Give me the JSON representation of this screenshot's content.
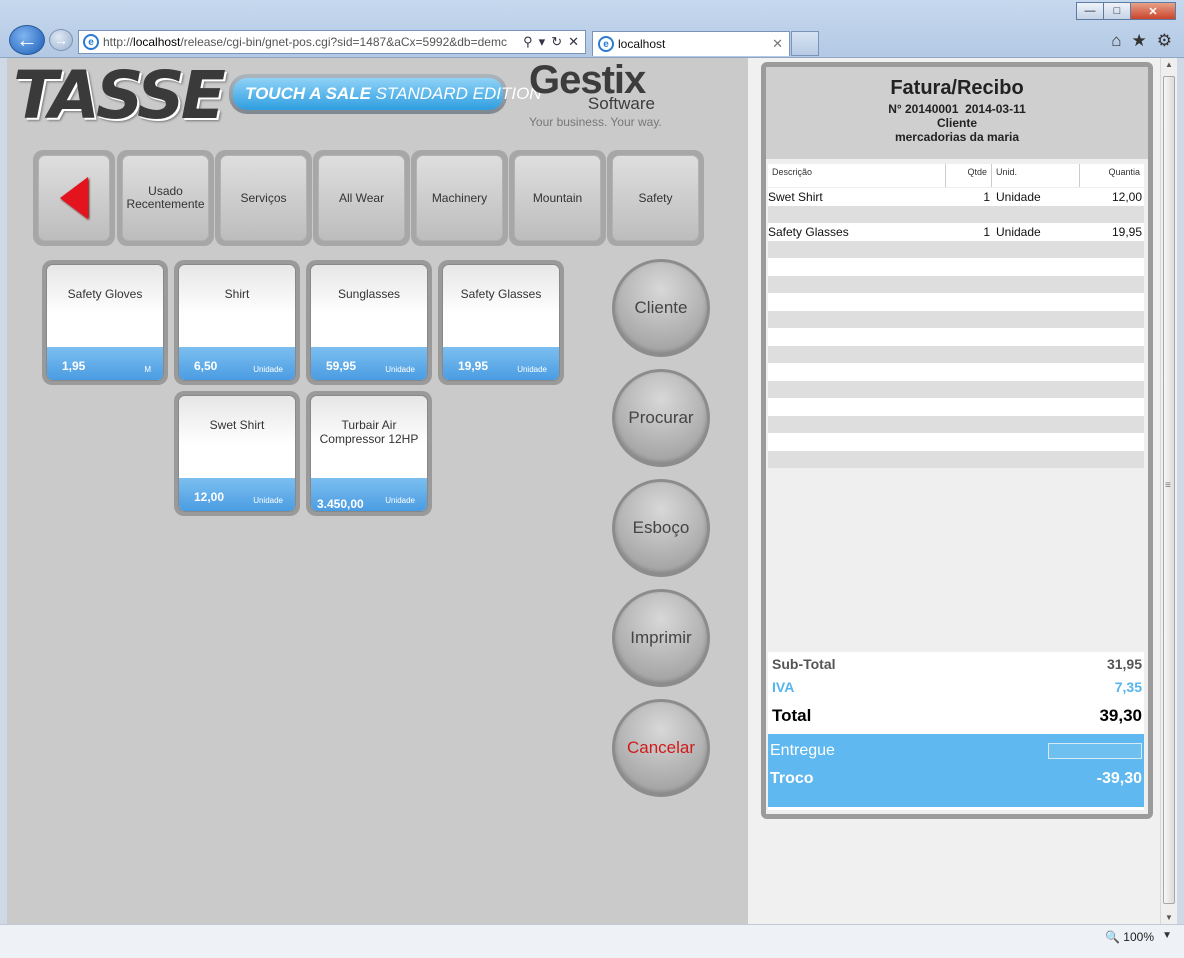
{
  "browser": {
    "url_prefix": "http://",
    "url_host": "localhost",
    "url_path": "/release/cgi-bin/gnet-pos.cgi?sid=1487&aCx=5992&db=demc",
    "tab_title": "localhost",
    "zoom": "100%"
  },
  "branding": {
    "tasse": "TASSE",
    "tagline_a": "TOUCH A SALE",
    "tagline_b": " STANDARD EDITION",
    "gestix": "Gestix",
    "software": "Software",
    "slogan": "Your business. Your way."
  },
  "categories": [
    {
      "label": "Usado Recentemente"
    },
    {
      "label": "Serviços"
    },
    {
      "label": "All Wear"
    },
    {
      "label": "Machinery"
    },
    {
      "label": "Mountain"
    },
    {
      "label": "Safety"
    }
  ],
  "products": [
    {
      "name": "Safety Gloves",
      "price": "1,95",
      "unit": "M"
    },
    {
      "name": "Shirt",
      "price": "6,50",
      "unit": "Unidade"
    },
    {
      "name": "Sunglasses",
      "price": "59,95",
      "unit": "Unidade"
    },
    {
      "name": "Safety Glasses",
      "price": "19,95",
      "unit": "Unidade"
    },
    {
      "name": "Swet Shirt",
      "price": "12,00",
      "unit": "Unidade"
    },
    {
      "name": "Turbair Air Compressor 12HP",
      "price": "3.450,00",
      "unit": "Unidade"
    }
  ],
  "actions": {
    "cliente": "Cliente",
    "procurar": "Procurar",
    "esboco": "Esboço",
    "imprimir": "Imprimir",
    "cancelar": "Cancelar"
  },
  "receipt": {
    "title": "Fatura/Recibo",
    "number_label": "N°",
    "number": "20140001",
    "date": "2014-03-11",
    "client_label": "Cliente",
    "client_name": "mercadorias da maria",
    "columns": {
      "desc": "Descrição",
      "qty": "Qtde",
      "unit": "Unid.",
      "amount": "Quantia"
    },
    "lines": [
      {
        "desc": "Swet Shirt",
        "qty": "1",
        "unit": "Unidade",
        "amount": "12,00"
      },
      {
        "desc": "",
        "qty": "",
        "unit": "",
        "amount": ""
      },
      {
        "desc": "Safety Glasses",
        "qty": "1",
        "unit": "Unidade",
        "amount": "19,95"
      }
    ],
    "subtotal_label": "Sub-Total",
    "subtotal": "31,95",
    "iva_label": "IVA",
    "iva": "7,35",
    "total_label": "Total",
    "total": "39,30",
    "delivered_label": "Entregue",
    "change_label": "Troco",
    "change": "-39,30"
  },
  "colors": {
    "accent_blue": "#5fb8ef",
    "cancel_red": "#d11a1a",
    "arrow_red": "#e3141d"
  }
}
